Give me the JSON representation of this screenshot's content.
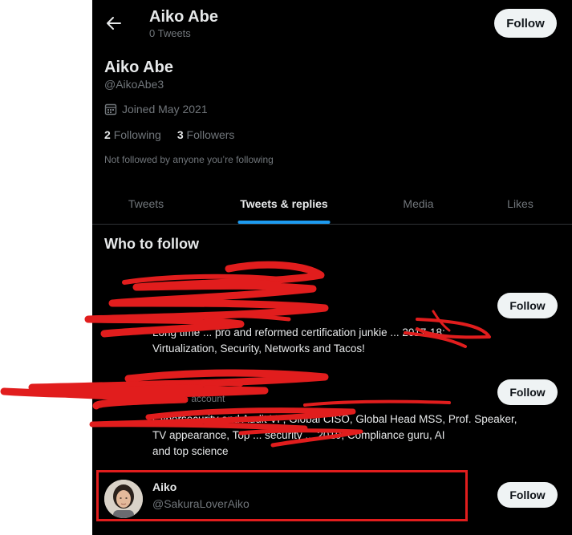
{
  "header": {
    "back_icon": "arrow-left-icon",
    "name": "Aiko Abe",
    "tweet_count": "0 Tweets",
    "follow_label": "Follow"
  },
  "profile": {
    "name": "Aiko Abe",
    "handle": "@AikoAbe3",
    "joined": "Joined May 2021",
    "calendar_icon": "calendar-icon",
    "following_count": "2",
    "following_label": "Following",
    "followers_count": "3",
    "followers_label": "Followers",
    "followed_by_note": "Not followed by anyone you’re following"
  },
  "tabs": [
    {
      "label": "Tweets",
      "active": false
    },
    {
      "label": "Tweets & replies",
      "active": true
    },
    {
      "label": "Media",
      "active": false
    },
    {
      "label": "Likes",
      "active": false
    }
  ],
  "who_to_follow": {
    "title": "Who to follow",
    "suggestions": [
      {
        "bio_line1": "Long time ... pro and reformed certification junkie ... 2017-18;",
        "bio_line2": "Virtualization, Security, Networks and Tacos!",
        "follow_label": "Follow",
        "redacted": true
      },
      {
        "social": "... account",
        "bio_line1": "Cybersecurity and Audit VP, Global CISO, Global Head MSS, Prof. Speaker,",
        "bio_line2": "TV appearance, Top ... security ... 2010, Compliance guru, AI",
        "bio_line3": "and top science",
        "follow_label": "Follow",
        "redacted": true
      },
      {
        "name": "Aiko",
        "handle": "@SakuraLoverAiko",
        "follow_label": "Follow",
        "highlighted": true
      }
    ]
  },
  "colors": {
    "background": "#000000",
    "text_primary": "#e7e9ea",
    "text_secondary": "#71767b",
    "accent": "#1d9bf0",
    "annotation_red": "#e11d1d"
  }
}
